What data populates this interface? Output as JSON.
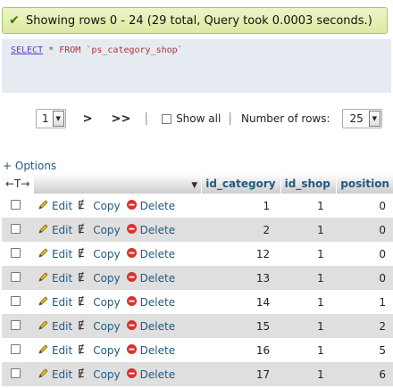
{
  "message": {
    "text": "Showing rows 0 - 24 (29 total, Query took 0.0003 seconds.)",
    "icon": "check-icon"
  },
  "sql": {
    "keyword": "SELECT",
    "star": "*",
    "rest": "FROM `ps_category_shop`"
  },
  "nav": {
    "page_value": "1",
    "next_label": ">",
    "last_label": ">>",
    "separator": "|",
    "show_all_label": "Show all",
    "rows_label": "Number of rows:",
    "rows_value": "25"
  },
  "options_label": "+ Options",
  "resize_label": "←T→",
  "columns": [
    "id_category",
    "id_shop",
    "position"
  ],
  "actions": {
    "edit": "Edit",
    "copy": "Copy",
    "delete": "Delete"
  },
  "rows": [
    [
      "1",
      "1",
      "0"
    ],
    [
      "2",
      "1",
      "0"
    ],
    [
      "12",
      "1",
      "0"
    ],
    [
      "13",
      "1",
      "0"
    ],
    [
      "14",
      "1",
      "1"
    ],
    [
      "15",
      "1",
      "2"
    ],
    [
      "16",
      "1",
      "5"
    ],
    [
      "17",
      "1",
      "6"
    ]
  ],
  "colors": {
    "link": "#235a81",
    "success_bg": "#e5efb6",
    "even_row": "#dfdfdf"
  }
}
